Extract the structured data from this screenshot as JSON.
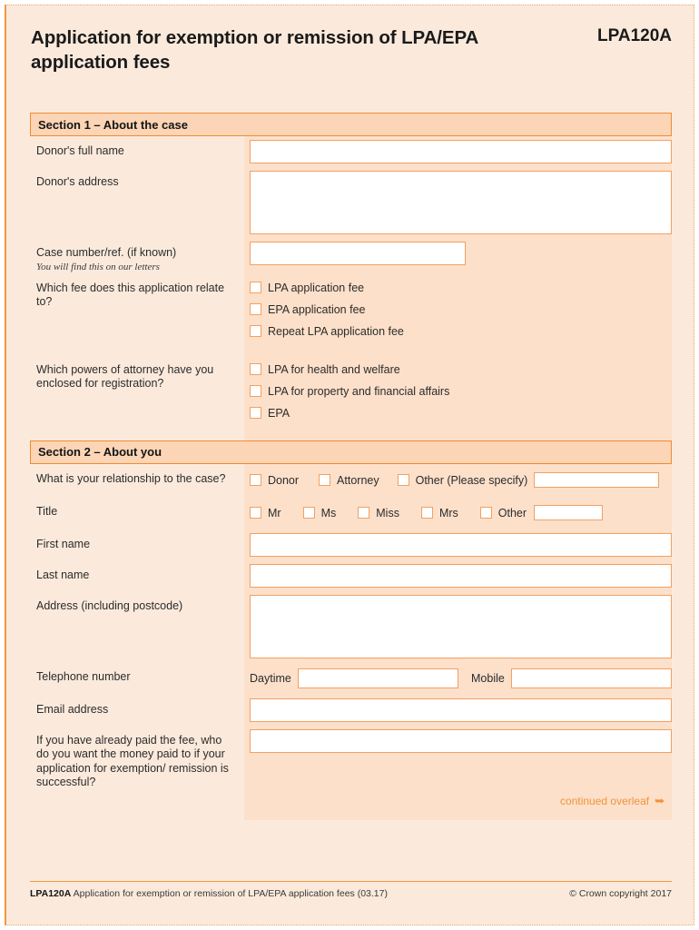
{
  "document": {
    "title": "Application for exemption or remission of LPA/EPA application fees",
    "form_code": "LPA120A",
    "form_code_prefix": "LPA",
    "form_code_suffix": "120A"
  },
  "colors": {
    "page_background": "#fbeadc",
    "field_column": "#fce0ca",
    "section_header": "#fbd5b5",
    "accent_orange": "#f5973d",
    "border_orange": "#f2a062",
    "text": "#2b2b2b"
  },
  "section1": {
    "heading": "Section 1 – About the case",
    "donor_name_label": "Donor's full name",
    "donor_name_value": "",
    "donor_address_label": "Donor's address",
    "donor_address_value": "",
    "case_number_label": "Case number/ref. (if known)",
    "case_number_hint": "You will find this on our letters",
    "case_number_value": "",
    "fee_question_label": "Which fee does this application relate to?",
    "fee_options": [
      "LPA application fee",
      "EPA application fee",
      "Repeat LPA application fee"
    ],
    "powers_question_label": "Which powers of attorney have you enclosed for registration?",
    "powers_options": [
      "LPA for health and welfare",
      "LPA for property and financial affairs",
      "EPA"
    ]
  },
  "section2": {
    "heading": "Section 2 – About you",
    "relationship_label": "What is your relationship to the case?",
    "relationship_options": [
      "Donor",
      "Attorney",
      "Other (Please specify)"
    ],
    "relationship_other_value": "",
    "title_label": "Title",
    "title_options": [
      "Mr",
      "Ms",
      "Miss",
      "Mrs",
      "Other"
    ],
    "title_other_value": "",
    "first_name_label": "First name",
    "first_name_value": "",
    "last_name_label": "Last name",
    "last_name_value": "",
    "address_label": "Address (including postcode)",
    "address_value": "",
    "telephone_label": "Telephone number",
    "daytime_label": "Daytime",
    "daytime_value": "",
    "mobile_label": "Mobile",
    "mobile_value": "",
    "email_label": "Email address",
    "email_value": "",
    "refund_label": "If you have already paid the fee, who do you want the money paid to if your application for exemption/ remission is successful?",
    "refund_value": ""
  },
  "continued": {
    "text": "continued overleaf",
    "arrow": "➥"
  },
  "footer": {
    "code": "LPA120A",
    "description": "Application for exemption or remission of LPA/EPA application fees (03.17)",
    "copyright": "© Crown copyright 2017"
  }
}
